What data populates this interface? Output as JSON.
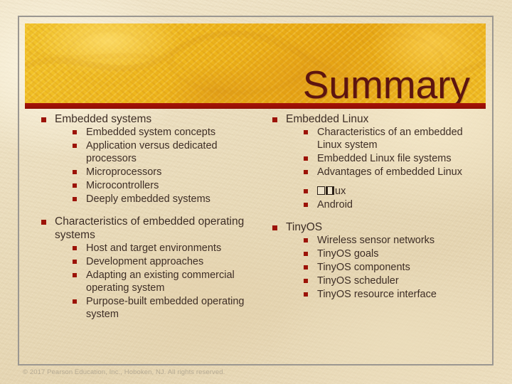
{
  "slide": {
    "title": "Summary",
    "footer": "© 2017 Pearson Education, Inc., Hoboken, NJ. All rights reserved.",
    "colors": {
      "background": "#eaddbe",
      "banner": "#edb61d",
      "accent_bar": "#9c1005",
      "title_text": "#5c1410",
      "body_text": "#3e2e26",
      "bullet": "#9c1307",
      "frame": "#9b9791",
      "footer_text": "#b5aa93"
    },
    "columns": {
      "left": [
        {
          "label": "Embedded systems",
          "children": [
            "Embedded system concepts",
            "Application versus dedicated processors",
            "Microprocessors",
            "Microcontrollers",
            "Deeply embedded systems"
          ]
        },
        {
          "label": "Characteristics of embedded operating systems",
          "children": [
            "Host and target environments",
            "Development approaches",
            "Adapting an existing commercial operating system",
            "Purpose-built embedded operating system"
          ]
        }
      ],
      "right": [
        {
          "label": "Embedded Linux",
          "children": [
            "Characteristics of an embedded Linux system",
            "Embedded Linux file systems",
            "Advantages of embedded Linux",
            "µClinux",
            "Android"
          ]
        },
        {
          "label": "TinyOS",
          "children": [
            "Wireless sensor networks",
            "TinyOS goals",
            "TinyOS components",
            "TinyOS scheduler",
            "TinyOS resource interface"
          ]
        }
      ]
    }
  }
}
